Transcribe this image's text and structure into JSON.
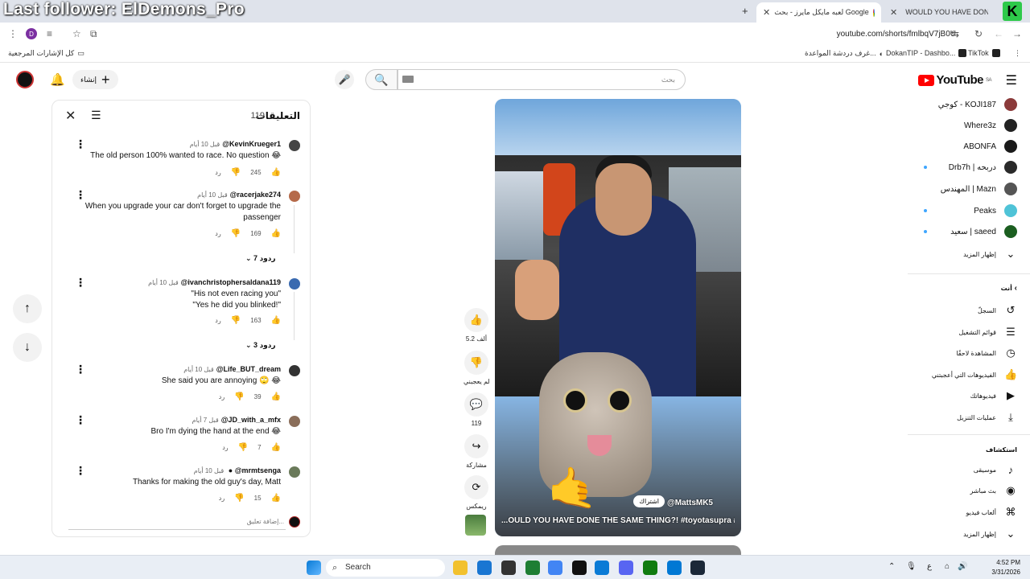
{
  "overlay": {
    "text": "Last follower: ElDemons_Pro"
  },
  "browser": {
    "tabs": [
      {
        "label": "WOULD YOU HAVE DONE",
        "active": true
      },
      {
        "label": "لعبه مايكل مايرز - بحث Google",
        "active": false
      }
    ],
    "url": "youtube.com/shorts/fmlbqV7jB0U",
    "profile_letter": "D",
    "bookmarks": [
      {
        "label": "كل الإشارات المرجعية"
      },
      {
        "label": "TikTok"
      },
      {
        "label": "DokanTIP - Dashbo..."
      },
      {
        "label": "غرف دردشة المواعدة..."
      }
    ]
  },
  "header": {
    "create_label": "إنشاء",
    "search_placeholder": "بحث",
    "logo_text": "YouTube",
    "logo_region": "SA"
  },
  "comments": {
    "title": "التعليقات",
    "count": "119",
    "add_placeholder": "إضافة تعليق...",
    "items": [
      {
        "author": "@KevinKrueger1",
        "time": "قبل 10 أيام",
        "text": "The old person 100% wanted to race. No question 😂",
        "likes": "245",
        "reply": "رد",
        "avatar": "#444",
        "replies": ""
      },
      {
        "author": "@racerjake274",
        "time": "قبل 10 أيام",
        "text": "When you upgrade your car don't forget to upgrade the passenger",
        "likes": "169",
        "reply": "رد",
        "avatar": "#b56a4a",
        "replies": "7 ردود"
      },
      {
        "author": "@ivanchristophersaldana119",
        "time": "قبل 10 أيام",
        "text": "\"His not even racing you\"\n\"Yes he did you blinked!\"",
        "likes": "163",
        "reply": "رد",
        "avatar": "#3a6ab0",
        "replies": "3 ردود"
      },
      {
        "author": "@Life_BUT_dream",
        "time": "قبل 10 أيام",
        "text": "She said you are annoying 🙄 😂",
        "likes": "39",
        "reply": "رد",
        "avatar": "#333",
        "replies": ""
      },
      {
        "author": "@JD_with_a_mfx",
        "time": "قبل 7 أيام",
        "text": "Bro I'm dying the hand at the end 😂",
        "likes": "7",
        "reply": "رد",
        "avatar": "#8a6e5a",
        "replies": ""
      },
      {
        "author": "@mrmtsenga",
        "time": "قبل 10 أيام",
        "text": "Thanks for making the old guy's day, Matt",
        "likes": "15",
        "reply": "رد",
        "avatar": "#6a7a5a",
        "replies": ""
      }
    ]
  },
  "video": {
    "channel": "@MattsMK5",
    "subscribe_label": "اشتراك",
    "title": "...OULD YOU HAVE DONE THE SAME THING?! #toyotasupra #toyota"
  },
  "actions": {
    "like_count": "5.2 ألف",
    "dislike_label": "لم يعجبني",
    "comment_count": "119",
    "share_label": "مشاركة",
    "remix_label": "ريمكس"
  },
  "sidebar": {
    "subscriptions": [
      {
        "name": "كوجي - KOJI187",
        "avatar": "#8b3a3a",
        "dot": false
      },
      {
        "name": "Where3z",
        "avatar": "#222",
        "dot": false
      },
      {
        "name": "ABONFA",
        "avatar": "#1a1a1a",
        "dot": false
      },
      {
        "name": "Drb7h | دربحه",
        "avatar": "#2a2a2a",
        "dot": true
      },
      {
        "name": "المهندس | Mazn",
        "avatar": "#555",
        "dot": false
      },
      {
        "name": "Peaks",
        "avatar": "#4fc3d7",
        "dot": true
      },
      {
        "name": "سعيد | saeed",
        "avatar": "#1b5e20",
        "dot": true
      }
    ],
    "show_more": "إظهار المزيد",
    "you_section": "أنت",
    "you_items": [
      {
        "label": "السجلّ",
        "icon": "history-icon",
        "glyph": "↺"
      },
      {
        "label": "قوائم التشغيل",
        "icon": "playlists-icon",
        "glyph": "☰"
      },
      {
        "label": "المشاهدة لاحقًا",
        "icon": "watch-later-icon",
        "glyph": "◷"
      },
      {
        "label": "الفيديوهات التي أعجبتني",
        "icon": "liked-icon",
        "glyph": "👍"
      },
      {
        "label": "فيديوهاتك",
        "icon": "your-videos-icon",
        "glyph": "▶"
      },
      {
        "label": "عمليات التنزيل",
        "icon": "download-icon",
        "glyph": "⤓"
      }
    ],
    "explore_section": "استكشاف",
    "explore_items": [
      {
        "label": "موسيقى",
        "icon": "music-icon",
        "glyph": "♪"
      },
      {
        "label": "بث مباشر",
        "icon": "live-icon",
        "glyph": "◉"
      },
      {
        "label": "ألعاب فيديو",
        "icon": "gaming-icon",
        "glyph": "⌘"
      }
    ],
    "explore_more": "إظهار المزيد"
  },
  "taskbar": {
    "search_label": "Search",
    "time": "4:52 PM",
    "date": "3/31/2026",
    "icons": [
      {
        "name": "file-explorer",
        "color": "#f2c12e"
      },
      {
        "name": "app-blue",
        "color": "#1976d2"
      },
      {
        "name": "app-dark",
        "color": "#333"
      },
      {
        "name": "app-green",
        "color": "#1e7e34"
      },
      {
        "name": "chrome",
        "color": "#4285f4"
      },
      {
        "name": "app-black",
        "color": "#111"
      },
      {
        "name": "edge",
        "color": "#0a7bd6"
      },
      {
        "name": "discord",
        "color": "#5865f2"
      },
      {
        "name": "xbox",
        "color": "#107c10"
      },
      {
        "name": "store",
        "color": "#0078d4"
      },
      {
        "name": "steam",
        "color": "#1b2838"
      }
    ]
  }
}
